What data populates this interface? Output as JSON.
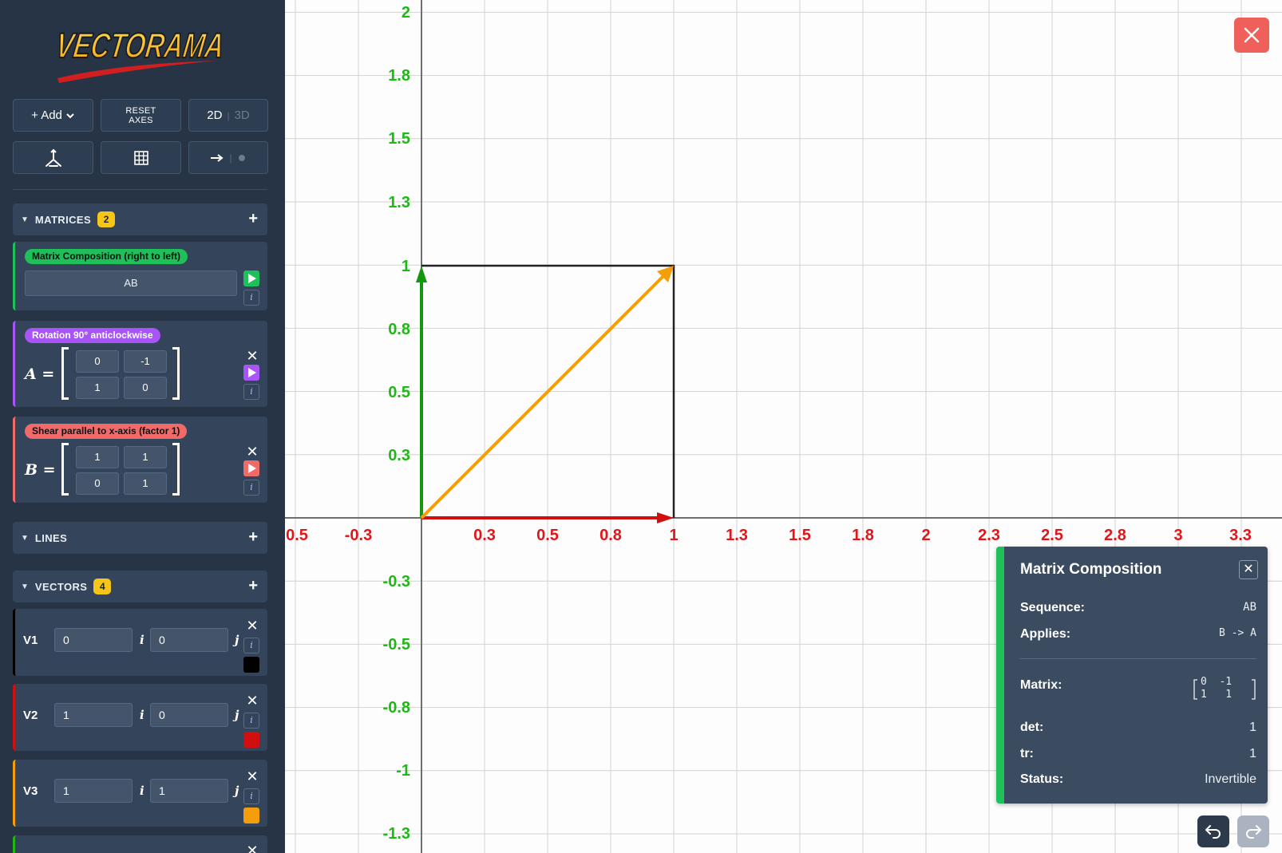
{
  "app": {
    "logo_text": "VECTORAMA"
  },
  "toolbar": {
    "add_label": "+ Add",
    "reset_label_1": "RESET",
    "reset_label_2": "AXES",
    "mode_2d": "2D",
    "mode_3d": "3D",
    "mode_sep": "|"
  },
  "matrices": {
    "title": "MATRICES",
    "count": "2",
    "composition": {
      "tag": "Matrix Composition (right to left)",
      "expression": "AB",
      "color": "#1fbf59"
    },
    "items": [
      {
        "tag": "Rotation 90° anticlockwise",
        "name": "A =",
        "color": "#a855f7",
        "values": [
          [
            "0",
            "-1"
          ],
          [
            "1",
            "0"
          ]
        ]
      },
      {
        "tag": "Shear parallel to x-axis (factor 1)",
        "name": "B =",
        "color": "#f06a6a",
        "values": [
          [
            "1",
            "1"
          ],
          [
            "0",
            "1"
          ]
        ]
      }
    ]
  },
  "lines": {
    "title": "LINES"
  },
  "vectors": {
    "title": "VECTORS",
    "count": "4",
    "items": [
      {
        "name": "V1",
        "i": "0",
        "j": "0",
        "color": "#000000"
      },
      {
        "name": "V2",
        "i": "1",
        "j": "0",
        "color": "#d20f0f"
      },
      {
        "name": "V3",
        "i": "1",
        "j": "1",
        "color": "#f59e0b"
      }
    ],
    "i_unit": "i",
    "j_unit": "j"
  },
  "plot": {
    "x_ticks": [
      "0.5",
      "-0.3",
      "0.3",
      "0.5",
      "0.8",
      "1",
      "1.3",
      "1.5",
      "1.8",
      "2",
      "2.3",
      "2.5",
      "2.8",
      "3",
      "3.3"
    ],
    "y_ticks": [
      "2",
      "1.8",
      "1.5",
      "1.3",
      "1",
      "0.8",
      "0.5",
      "0.3",
      "-0.3",
      "-0.5",
      "-0.8",
      "-1",
      "-1.3"
    ],
    "x_tick_color": "#e0161b",
    "y_tick_color": "#1fb817"
  },
  "info_panel": {
    "title": "Matrix Composition",
    "sequence_label": "Sequence:",
    "sequence_value": "AB",
    "applies_label": "Applies:",
    "applies_value": "B -> A",
    "matrix_label": "Matrix:",
    "matrix_row1": "0  -1",
    "matrix_row2": "1   1",
    "det_label": "det:",
    "det_value": "1",
    "tr_label": "tr:",
    "tr_value": "1",
    "status_label": "Status:",
    "status_value": "Invertible"
  }
}
